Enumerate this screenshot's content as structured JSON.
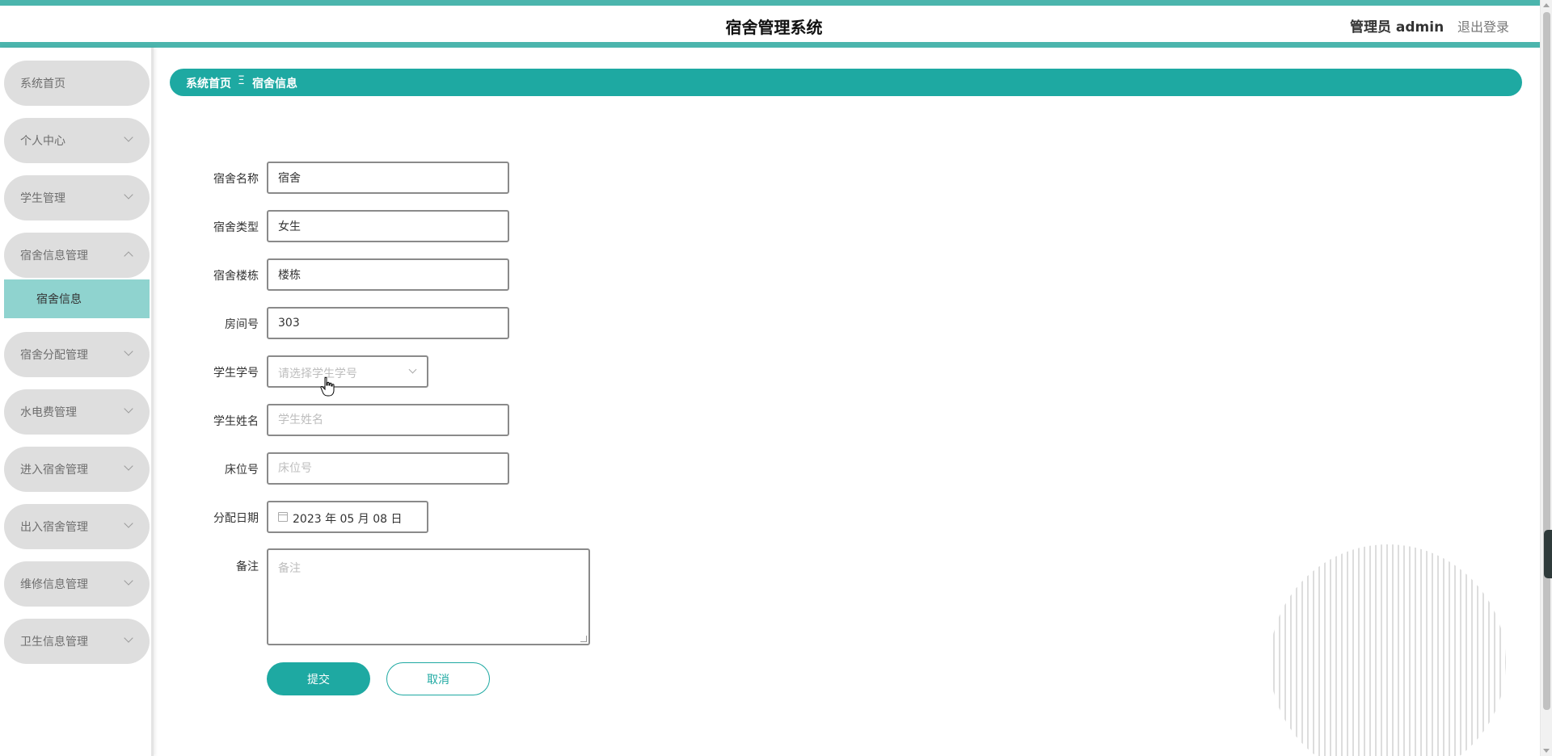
{
  "header": {
    "app_title": "宿舍管理系统",
    "user_label": "管理员 admin",
    "logout_label": "退出登录",
    "accent_color": "#1ea9a2"
  },
  "sidebar": {
    "items": [
      {
        "label": "系统首页",
        "has_chevron": false
      },
      {
        "label": "个人中心",
        "has_chevron": true
      },
      {
        "label": "学生管理",
        "has_chevron": true
      },
      {
        "label": "宿舍信息管理",
        "has_chevron": true,
        "expanded": true
      },
      {
        "label": "宿舍分配管理",
        "has_chevron": true
      },
      {
        "label": "水电费管理",
        "has_chevron": true
      },
      {
        "label": "进入宿舍管理",
        "has_chevron": true
      },
      {
        "label": "出入宿舍管理",
        "has_chevron": true
      },
      {
        "label": "维修信息管理",
        "has_chevron": true
      },
      {
        "label": "卫生信息管理",
        "has_chevron": true
      }
    ],
    "active_subitem": {
      "label": "宿舍信息"
    }
  },
  "breadcrumb": {
    "home": "系统首页",
    "separator": "Ξ",
    "current": "宿舍信息"
  },
  "form": {
    "dorm_name": {
      "label": "宿舍名称",
      "value": "宿舍"
    },
    "dorm_type": {
      "label": "宿舍类型",
      "value": "女生"
    },
    "dorm_building": {
      "label": "宿舍楼栋",
      "value": "楼栋"
    },
    "room_number": {
      "label": "房间号",
      "value": "303"
    },
    "student_id": {
      "label": "学生学号",
      "placeholder": "请选择学生学号"
    },
    "student_name": {
      "label": "学生姓名",
      "placeholder": "学生姓名"
    },
    "bed_number": {
      "label": "床位号",
      "placeholder": "床位号"
    },
    "assign_date": {
      "label": "分配日期",
      "value": "2023 年 05 月 08 日"
    },
    "remark": {
      "label": "备注",
      "placeholder": "备注"
    },
    "submit_label": "提交",
    "cancel_label": "取消"
  }
}
